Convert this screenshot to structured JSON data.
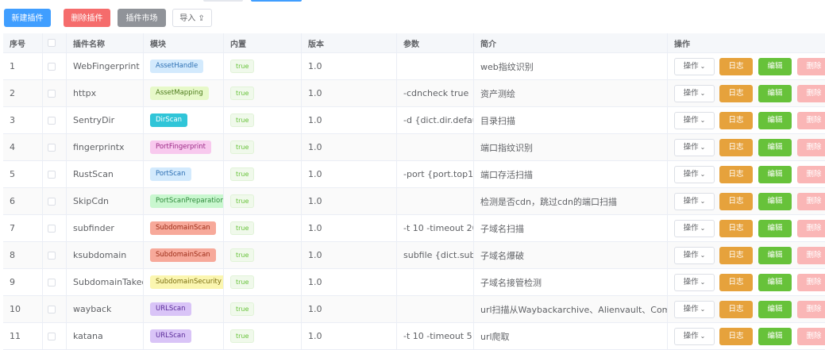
{
  "toolbar": {
    "new_label": "新建插件",
    "delete_label": "删除插件",
    "market_label": "插件市场",
    "import_label": "导入 ⇪"
  },
  "columns": {
    "no": "序号",
    "name": "插件名称",
    "module": "模块",
    "builtin": "内置",
    "version": "版本",
    "args": "参数",
    "desc": "简介",
    "actions": "操作"
  },
  "actions": {
    "dropdown": "操作",
    "log": "日志",
    "edit": "编辑",
    "delete": "删除"
  },
  "colors": {
    "primary": "#409eff",
    "danger": "#f56c6c",
    "warning": "#e6a23c",
    "success": "#67c23a"
  },
  "rows": [
    {
      "no": "1",
      "name": "WebFingerprint",
      "module": "AssetHandle",
      "builtin": "true",
      "version": "1.0",
      "args": "",
      "desc": "web指纹识别",
      "tag_bg": "#d3eafd",
      "tag_fg": "#2c6fb3"
    },
    {
      "no": "2",
      "name": "httpx",
      "module": "AssetMapping",
      "builtin": "true",
      "version": "1.0",
      "args": "-cdncheck true",
      "desc": "资产测绘",
      "tag_bg": "#e7f9c9",
      "tag_fg": "#4c7a1b"
    },
    {
      "no": "3",
      "name": "SentryDir",
      "module": "DirScan",
      "builtin": "true",
      "version": "1.0",
      "args": "-d {dict.dir.defaul…",
      "desc": "目录扫描",
      "tag_bg": "#30c5d8",
      "tag_fg": "#ffffff"
    },
    {
      "no": "4",
      "name": "fingerprintx",
      "module": "PortFingerprint",
      "builtin": "true",
      "version": "1.0",
      "args": "",
      "desc": "端口指纹识别",
      "tag_bg": "#f8c9ee",
      "tag_fg": "#9c2a86"
    },
    {
      "no": "5",
      "name": "RustScan",
      "module": "PortScan",
      "builtin": "true",
      "version": "1.0",
      "args": "-port {port.top10…",
      "desc": "端口存活扫描",
      "tag_bg": "#d3eafd",
      "tag_fg": "#2c6fb3"
    },
    {
      "no": "6",
      "name": "SkipCdn",
      "module": "PortScanPreparation",
      "builtin": "true",
      "version": "1.0",
      "args": "",
      "desc": "检测是否cdn，跳过cdn的端口扫描",
      "tag_bg": "#c9f7cf",
      "tag_fg": "#2f8a3c"
    },
    {
      "no": "7",
      "name": "subfinder",
      "module": "SubdomainScan",
      "builtin": "true",
      "version": "1.0",
      "args": "-t 10 -timeout 20…",
      "desc": "子域名扫描",
      "tag_bg": "#f7a99a",
      "tag_fg": "#9c2c17"
    },
    {
      "no": "8",
      "name": "ksubdomain",
      "module": "SubdomainScan",
      "builtin": "true",
      "version": "1.0",
      "args": "subfile {dict.sub…",
      "desc": "子域名爆破",
      "tag_bg": "#f7a99a",
      "tag_fg": "#9c2c17"
    },
    {
      "no": "9",
      "name": "SubdomainTakeo…",
      "module": "SubdomainSecurity",
      "builtin": "true",
      "version": "1.0",
      "args": "",
      "desc": "子域名接管检测",
      "tag_bg": "#fbf6b0",
      "tag_fg": "#7a6d10"
    },
    {
      "no": "10",
      "name": "wayback",
      "module": "URLScan",
      "builtin": "true",
      "version": "1.0",
      "args": "",
      "desc": "url扫描从Waybackarchive、Alienvault、Commoncra…",
      "tag_bg": "#d9c4f7",
      "tag_fg": "#5a2b99"
    },
    {
      "no": "11",
      "name": "katana",
      "module": "URLScan",
      "builtin": "true",
      "version": "1.0",
      "args": "-t 10 -timeout 5 …",
      "desc": "url爬取",
      "tag_bg": "#d9c4f7",
      "tag_fg": "#5a2b99"
    }
  ]
}
